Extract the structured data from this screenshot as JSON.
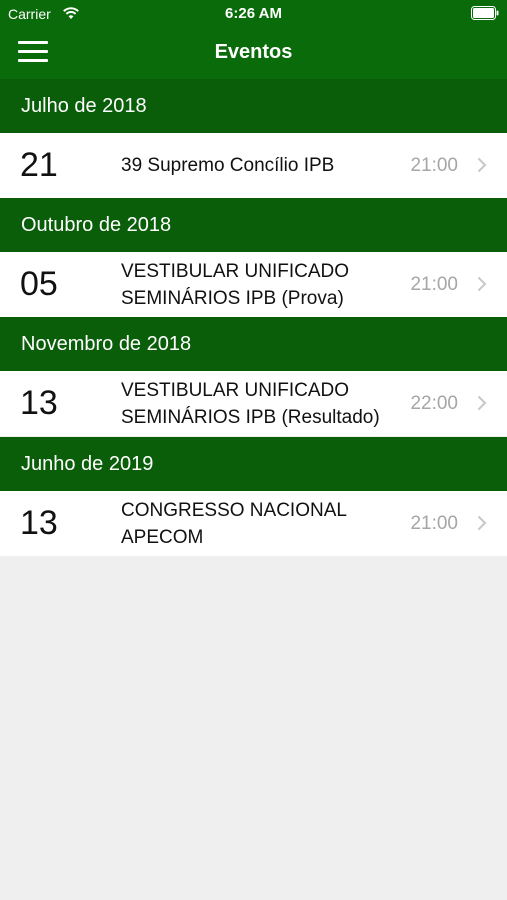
{
  "status": {
    "carrier": "Carrier",
    "time": "6:26 AM"
  },
  "nav": {
    "title": "Eventos"
  },
  "colors": {
    "nav_green": "#0a6b0a",
    "section_green": "#0a5e0a",
    "time_gray": "#a6a6a6",
    "background": "#efefef"
  },
  "sections": [
    {
      "header": "Julho de 2018",
      "event": {
        "day": "21",
        "title": "39 Supremo Concílio IPB",
        "time": "21:00"
      }
    },
    {
      "header": "Outubro de 2018",
      "event": {
        "day": "05",
        "title": "VESTIBULAR UNIFICADO SEMINÁRIOS IPB (Prova)",
        "time": "21:00"
      }
    },
    {
      "header": "Novembro de 2018",
      "event": {
        "day": "13",
        "title": "VESTIBULAR UNIFICADO SEMINÁRIOS IPB (Resultado)",
        "time": "22:00"
      }
    },
    {
      "header": "Junho de 2019",
      "event": {
        "day": "13",
        "title": "CONGRESSO NACIONAL APECOM",
        "time": "21:00"
      }
    }
  ]
}
